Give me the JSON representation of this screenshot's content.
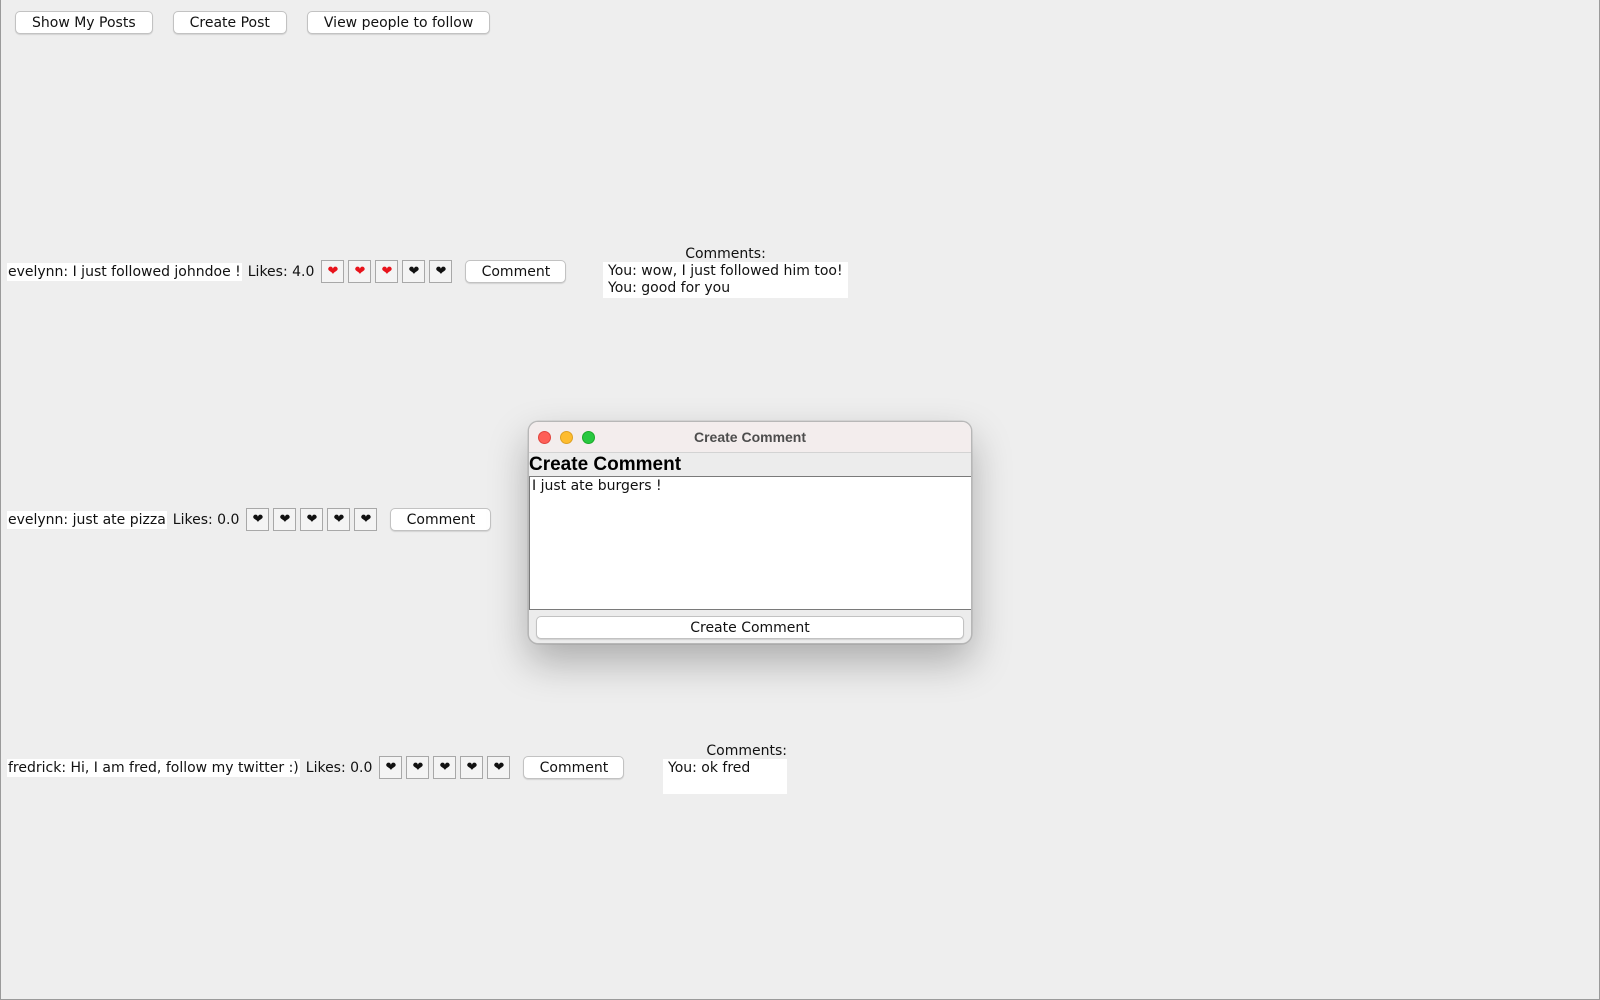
{
  "toolbar": {
    "show_my_posts": "Show My Posts",
    "create_post": "Create Post",
    "view_people": "View people to follow"
  },
  "posts": [
    {
      "text": "evelynn: I just followed johndoe !",
      "likes": "Likes: 4.0",
      "hearts": [
        "red",
        "red",
        "red",
        "black",
        "black"
      ],
      "comment_button": "Comment",
      "comments_title": "Comments:",
      "comments": [
        "You: wow, I just followed him too!",
        "You: good for you"
      ]
    },
    {
      "text": "evelynn: just ate pizza",
      "likes": "Likes: 0.0",
      "hearts": [
        "black",
        "black",
        "black",
        "black",
        "black"
      ],
      "comment_button": "Comment"
    },
    {
      "text": "fredrick: Hi, I am fred, follow my twitter :)",
      "likes": "Likes: 0.0",
      "hearts": [
        "black",
        "black",
        "black",
        "black",
        "black"
      ],
      "comment_button": "Comment",
      "comments_title": "Comments:",
      "comments": [
        "You: ok fred"
      ]
    }
  ],
  "heart_glyph": "❤",
  "icons": {
    "like": "heart-icon"
  },
  "colors": {
    "liked_heart": "#e8131b",
    "unliked_heart": "#111111",
    "close_light": "#fe5f57",
    "minimize_light": "#febc2e",
    "maximize_light": "#28c840"
  },
  "dialog": {
    "window_title": "Create Comment",
    "heading": "Create Comment",
    "text_value": "I just ate burgers !",
    "submit_label": "Create Comment"
  }
}
